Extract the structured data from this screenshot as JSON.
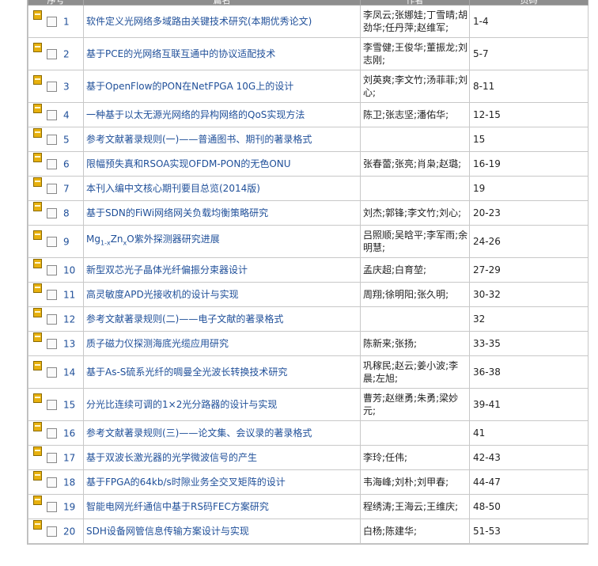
{
  "header": {
    "col_no": "序号",
    "col_title": "篇名",
    "col_authors": "作者",
    "col_pages": "页码"
  },
  "rows": [
    {
      "no": "1",
      "title": "软件定义光网络多域路由关键技术研究(本期优秀论文)",
      "authors": "李凤云;张娜娃;丁雪晴;胡劲华;任丹萍;赵维军;",
      "pages": "1-4",
      "tall": true
    },
    {
      "no": "2",
      "title": "基于PCE的光网络互联互通中的协议适配技术",
      "authors": "李雪健;王俊华;董振龙;刘志刚;",
      "pages": "5-7",
      "tall": true
    },
    {
      "no": "3",
      "title": "基于OpenFlow的PON在NetFPGA 10G上的设计",
      "authors": "刘英爽;李文竹;汤菲菲;刘心;",
      "pages": "8-11",
      "tall": true
    },
    {
      "no": "4",
      "title": "一种基于以太无源光网络的异构网络的QoS实现方法",
      "authors": "陈卫;张志坚;潘佑华;",
      "pages": "12-15",
      "tall": false
    },
    {
      "no": "5",
      "title": "参考文献著录规则(一)——普通图书、期刊的著录格式",
      "authors": "",
      "pages": "15",
      "tall": false
    },
    {
      "no": "6",
      "title": "限幅预失真和RSOA实现OFDM-PON的无色ONU",
      "authors": "张春蕾;张亮;肖枭;赵璐;",
      "pages": "16-19",
      "tall": false
    },
    {
      "no": "7",
      "title": "本刊入编中文核心期刊要目总览(2014版)",
      "authors": "",
      "pages": "19",
      "tall": false
    },
    {
      "no": "8",
      "title": "基于SDN的FiWi网络网关负载均衡策略研究",
      "authors": "刘杰;郭锋;李文竹;刘心;",
      "pages": "20-23",
      "tall": false
    },
    {
      "no": "9",
      "title_pre": "Mg",
      "title_sub1": "1-x",
      "title_mid": "Zn",
      "title_sub2": "x",
      "title_post": "O紫外探测器研究进展",
      "authors": "吕照顺;吴晗平;李军雨;余明慧;",
      "pages": "24-26",
      "tall": true,
      "rich": true
    },
    {
      "no": "10",
      "title": "新型双芯光子晶体光纤偏振分束器设计",
      "authors": "孟庆超;白育堃;",
      "pages": "27-29",
      "tall": false
    },
    {
      "no": "11",
      "title": "高灵敏度APD光接收机的设计与实现",
      "authors": "周翔;徐明阳;张久明;",
      "pages": "30-32",
      "tall": false
    },
    {
      "no": "12",
      "title": "参考文献著录规则(二)——电子文献的著录格式",
      "authors": "",
      "pages": "32",
      "tall": false
    },
    {
      "no": "13",
      "title": "质子磁力仪探测海底光缆应用研究",
      "authors": "陈新来;张扬;",
      "pages": "33-35",
      "tall": false
    },
    {
      "no": "14",
      "title": "基于As-S硫系光纤的啁曼全光波长转换技术研究",
      "authors": "巩稼民;赵云;姜小波;李晨;左旭;",
      "pages": "36-38",
      "tall": true
    },
    {
      "no": "15",
      "title": "分光比连续可调的1×2光分路器的设计与实现",
      "authors": "曹芳;赵继勇;朱勇;梁妙元;",
      "pages": "39-41",
      "tall": true
    },
    {
      "no": "16",
      "title": "参考文献著录规则(三)——论文集、会议录的著录格式",
      "authors": "",
      "pages": "41",
      "tall": false
    },
    {
      "no": "17",
      "title": "基于双波长激光器的光学微波信号的产生",
      "authors": "李玲;任伟;",
      "pages": "42-43",
      "tall": false
    },
    {
      "no": "18",
      "title": "基于FPGA的64kb/s时隙业务全交叉矩阵的设计",
      "authors": "韦海峰;刘朴;刘甲春;",
      "pages": "44-47",
      "tall": false
    },
    {
      "no": "19",
      "title": "智能电网光纤通信中基于RS码FEC方案研究",
      "authors": "程绣涛;王海云;王维庆;",
      "pages": "48-50",
      "tall": false
    },
    {
      "no": "20",
      "title": "SDH设备网管信息传输方案设计与实现",
      "authors": "白杨;陈建华;",
      "pages": "51-53",
      "tall": false
    }
  ]
}
